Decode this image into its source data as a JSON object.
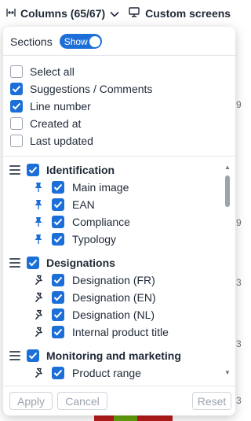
{
  "toolbar": {
    "columns_label": "Columns (65/67)",
    "screens_label": "Custom screens"
  },
  "popup": {
    "sections_label": "Sections",
    "sections_toggle": {
      "label": "Show",
      "on": true
    },
    "options": [
      {
        "label": "Select all",
        "checked": false
      },
      {
        "label": "Suggestions / Comments",
        "checked": true
      },
      {
        "label": "Line number",
        "checked": true
      },
      {
        "label": "Created at",
        "checked": false
      },
      {
        "label": "Last updated",
        "checked": false
      }
    ],
    "groups": [
      {
        "title": "Identification",
        "checked": true,
        "items": [
          {
            "label": "Main image",
            "checked": true,
            "pinned": true
          },
          {
            "label": "EAN",
            "checked": true,
            "pinned": true
          },
          {
            "label": "Compliance",
            "checked": true,
            "pinned": true
          },
          {
            "label": "Typology",
            "checked": true,
            "pinned": true
          }
        ]
      },
      {
        "title": "Designations",
        "checked": true,
        "items": [
          {
            "label": "Designation (FR)",
            "checked": true,
            "pinned": false
          },
          {
            "label": "Designation (EN)",
            "checked": true,
            "pinned": false
          },
          {
            "label": "Designation (NL)",
            "checked": true,
            "pinned": false
          },
          {
            "label": "Internal product title",
            "checked": true,
            "pinned": false
          }
        ]
      },
      {
        "title": "Monitoring and marketing",
        "checked": true,
        "items": [
          {
            "label": "Product range",
            "checked": true,
            "pinned": false
          }
        ]
      }
    ],
    "buttons": {
      "apply": "Apply",
      "cancel": "Cancel",
      "reset": "Reset"
    }
  },
  "background": {
    "edge_chars": [
      "9",
      "9",
      "3",
      "3",
      "3"
    ]
  },
  "colors": {
    "accent": "#1d6fd8",
    "pinned_icon": "#1d6fd8",
    "unpinned_icon": "#1f2937"
  }
}
